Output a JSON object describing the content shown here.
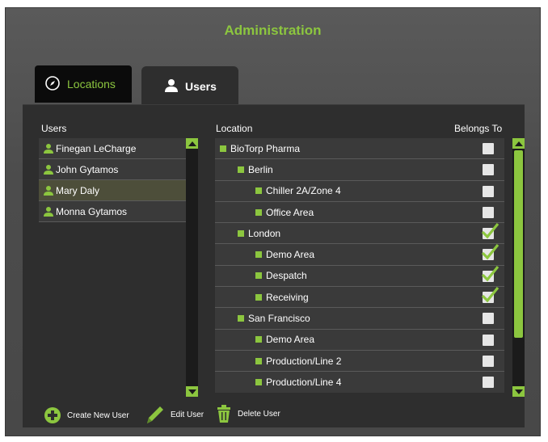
{
  "app": {
    "title": "Administration"
  },
  "tabs": [
    {
      "label": "Locations",
      "icon": "compass-icon",
      "active": false
    },
    {
      "label": "Users",
      "icon": "user-icon",
      "active": true
    }
  ],
  "users": {
    "header": "Users",
    "items": [
      {
        "name": "Finegan LeCharge",
        "selected": false
      },
      {
        "name": "John Gytamos",
        "selected": false
      },
      {
        "name": "Mary Daly",
        "selected": true
      },
      {
        "name": "Monna Gytamos",
        "selected": false
      }
    ]
  },
  "locations": {
    "header_location": "Location",
    "header_belongs": "Belongs To",
    "items": [
      {
        "name": "BioTorp Pharma",
        "level": 0,
        "belongs": false
      },
      {
        "name": "Berlin",
        "level": 1,
        "belongs": false
      },
      {
        "name": "Chiller 2A/Zone 4",
        "level": 2,
        "belongs": false
      },
      {
        "name": "Office Area",
        "level": 2,
        "belongs": false
      },
      {
        "name": "London",
        "level": 1,
        "belongs": true
      },
      {
        "name": "Demo Area",
        "level": 2,
        "belongs": true
      },
      {
        "name": "Despatch",
        "level": 2,
        "belongs": true
      },
      {
        "name": "Receiving",
        "level": 2,
        "belongs": true
      },
      {
        "name": "San Francisco",
        "level": 1,
        "belongs": false
      },
      {
        "name": "Demo Area",
        "level": 2,
        "belongs": false
      },
      {
        "name": "Production/Line 2",
        "level": 2,
        "belongs": false
      },
      {
        "name": "Production/Line 4",
        "level": 2,
        "belongs": false
      }
    ]
  },
  "footer": {
    "create_label": "Create New User",
    "edit_label": "Edit User",
    "delete_label": "Delete User"
  },
  "colors": {
    "accent": "#8cc63f",
    "panel": "#2e2e2e",
    "row": "#3a3a3a"
  }
}
